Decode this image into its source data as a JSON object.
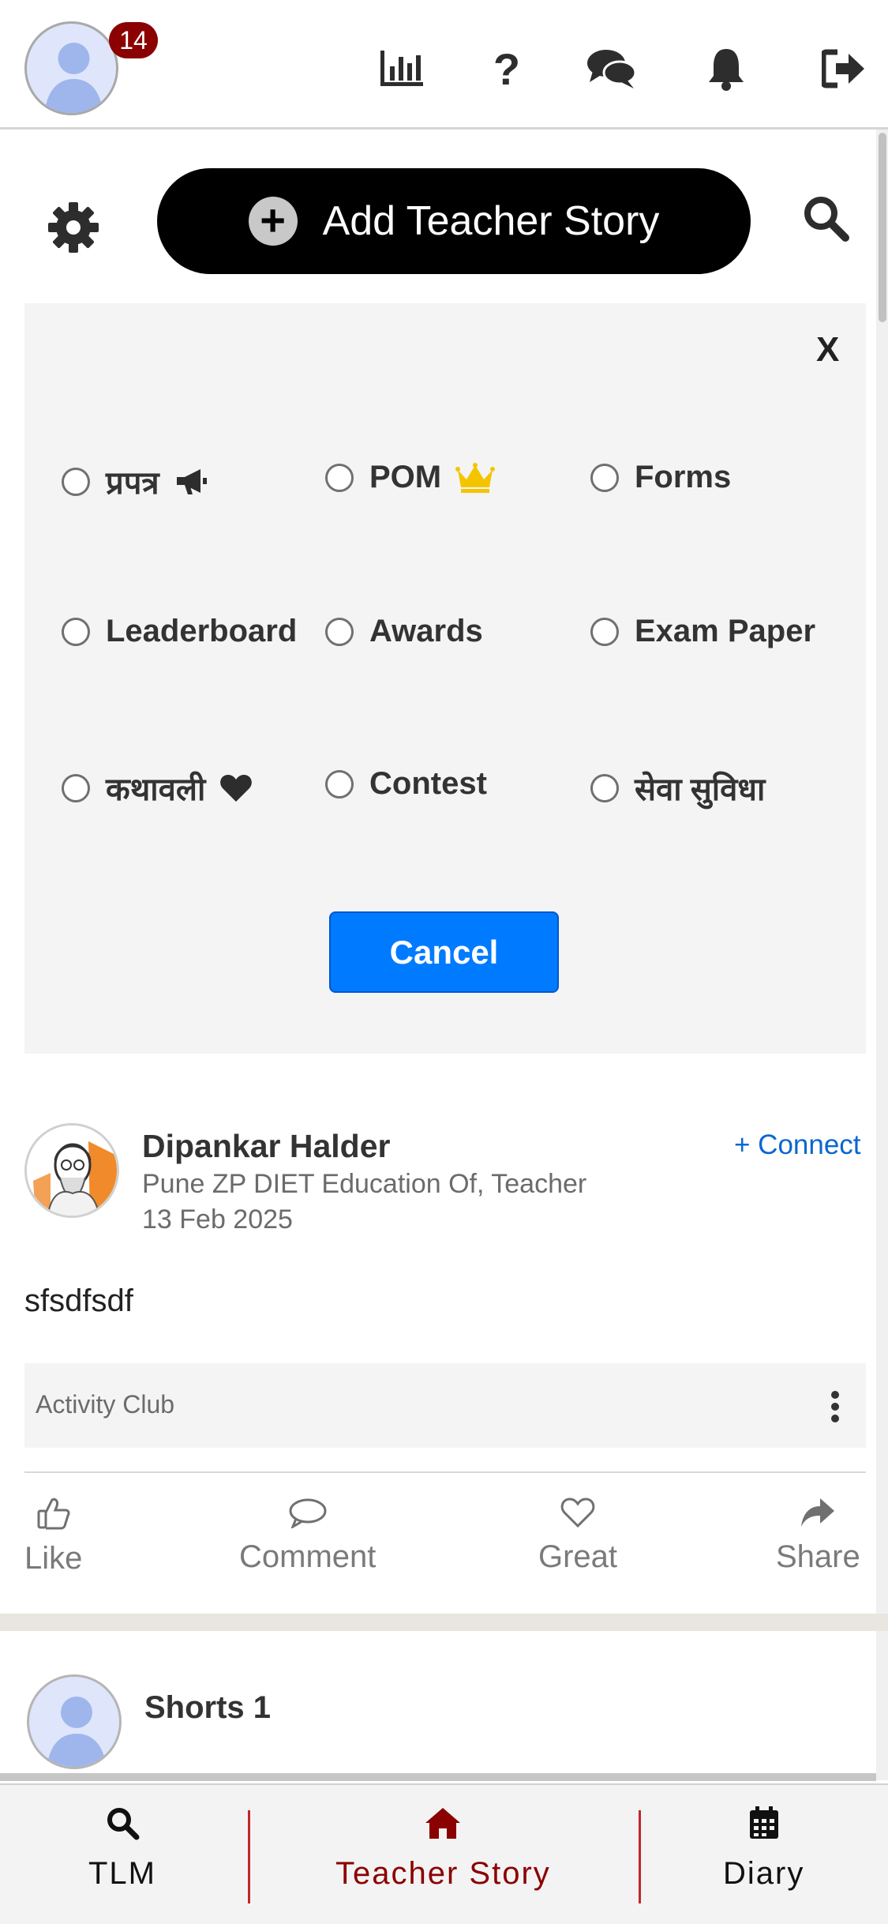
{
  "header": {
    "notification_count": "14",
    "icons": [
      "stats-icon",
      "help-icon",
      "chat-icon",
      "bell-icon",
      "logout-icon"
    ]
  },
  "actions": {
    "add_story_label": "Add Teacher Story"
  },
  "filter_panel": {
    "close_label": "X",
    "options": [
      "प्रपत्र",
      "POM",
      "Forms",
      "Leaderboard",
      "Awards",
      "Exam Paper",
      "कथावली",
      "Contest",
      "सेवा सुविधा"
    ],
    "cancel_label": "Cancel",
    "colors": {
      "cancel": "#007bff",
      "crown": "#f5c400"
    }
  },
  "post": {
    "author": "Dipankar Halder",
    "role": "Pune ZP DIET Education Of, Teacher",
    "date": "13 Feb 2025",
    "connect_label": "+ Connect",
    "text": "sfsdfsdf",
    "club": "Activity Club",
    "reactions": [
      "Like",
      "Comment",
      "Great",
      "Share"
    ]
  },
  "next_post": {
    "title": "Shorts 1"
  },
  "bottom_nav": {
    "items": [
      "TLM",
      "Teacher Story",
      "Diary"
    ],
    "active": "Teacher Story",
    "colors": {
      "active": "#8b0000",
      "separator": "#c0272d"
    }
  }
}
